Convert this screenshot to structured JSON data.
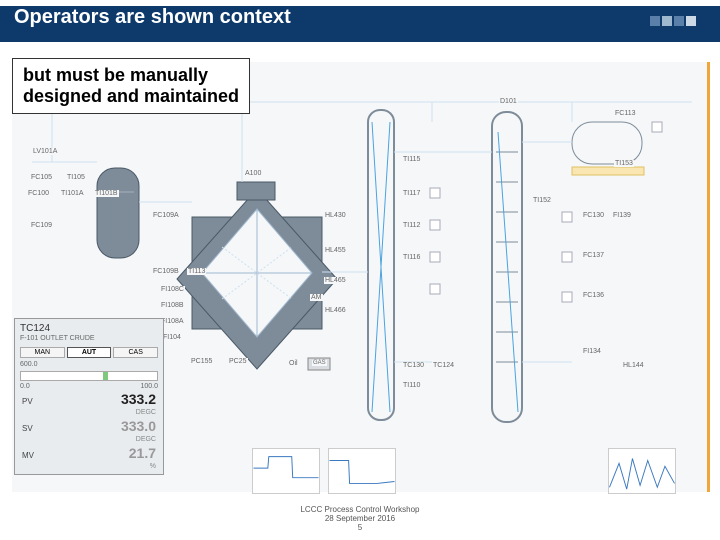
{
  "header": {
    "title": "Operators are shown context"
  },
  "callout": {
    "text": "but must be manually\ndesigned and maintained"
  },
  "faceplate": {
    "tag": "TC124",
    "desc": "F-101 OUTLET CRUDE",
    "modes": {
      "man": "MAN",
      "aut": "AUT",
      "cas": "CAS",
      "active": "aut"
    },
    "scale": {
      "lo": "0.0",
      "mid": "600.0",
      "hi": "100.0"
    },
    "pv": {
      "label": "PV",
      "value": "333.2",
      "unit": "DEGC"
    },
    "sv": {
      "label": "SV",
      "value": "333.0",
      "unit": "DEGC"
    },
    "mv": {
      "label": "MV",
      "value": "21.7",
      "unit": "%"
    }
  },
  "tags": {
    "lv101a": "LV101A",
    "fc105": "FC105",
    "ti105": "TI105",
    "fc100": "FC100",
    "ti101a": "TI101A",
    "ti101b": "TI101B",
    "fc109": "FC109",
    "a100": "A100",
    "fc109a": "FC109A",
    "fc109b": "FC109B",
    "ti113": "TI113",
    "fi108c": "FI108C",
    "fi108b": "FI108B",
    "fi108a": "FI108A",
    "fi104": "FI104",
    "am": "AM",
    "pc155": "PC155",
    "pc25": "PC25",
    "oil": "Oil",
    "gas": "GAS",
    "ti115": "TI115",
    "ti117": "TI117",
    "ti112": "TI112",
    "ti116": "TI116",
    "hl430": "HL430",
    "hl455": "HL455",
    "hl465": "HL465",
    "hl466": "HL466",
    "tc130": "TC130",
    "tc124": "TC124",
    "ti110": "TI110",
    "d101": "D101",
    "fc113": "FC113",
    "ti153": "TI153",
    "ti152": "TI152",
    "fi139": "FI139",
    "fc130": "FC130",
    "fc137": "FC137",
    "fc136": "FC136",
    "fi134": "FI134",
    "hl144": "HL144"
  },
  "footer": {
    "line1": "LCCC Process Control Workshop",
    "line2": "28 September 2016",
    "page": "5"
  }
}
